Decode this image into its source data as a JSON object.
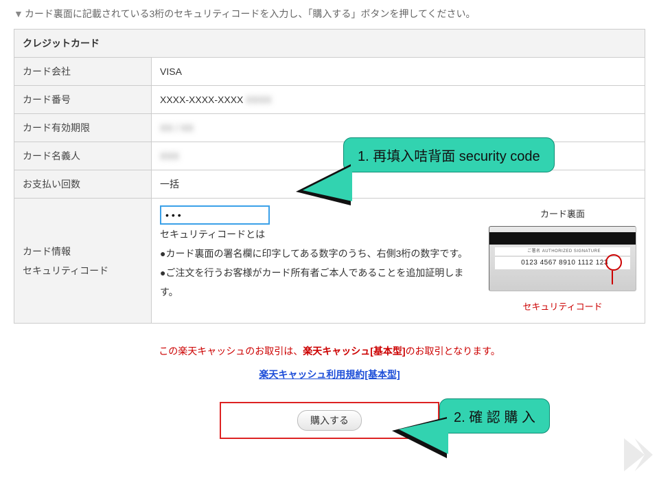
{
  "instruction": "カード裏面に記載されている3桁のセキュリティコードを入力し、「購入する」ボタンを押してください。",
  "table_header": "クレジットカード",
  "rows": {
    "card_company": {
      "label": "カード会社",
      "value": "VISA"
    },
    "card_number": {
      "label": "カード番号",
      "value": "XXXX-XXXX-XXXX",
      "masked_tail": "XXXX"
    },
    "expiry": {
      "label": "カード有効期限",
      "value_masked": "XX / XX"
    },
    "holder": {
      "label": "カード名義人",
      "value_masked": "XXX"
    },
    "installments": {
      "label": "お支払い回数",
      "value": "一括"
    }
  },
  "security": {
    "row_label_line1": "カード情報",
    "row_label_line2": "セキュリティコード",
    "input_value": "•••",
    "what_is": "セキュリティコードとは",
    "desc1": "●カード裏面の署名欄に印字してある数字のうち、右側3桁の数字です。",
    "desc2": "●ご注文を行うお客様がカード所有者ご本人であることを追加証明します。",
    "card_back_title": "カード裏面",
    "card_sig_text": "ご署名 AUTHORIZED SIGNATURE",
    "card_num_text": "0123 4567 8910 1112 123",
    "card_back_label": "セキュリティコード"
  },
  "notice": {
    "pre": "この楽天キャッシュのお取引は、",
    "bold": "楽天キャッシュ[基本型]",
    "post": "のお取引となります。"
  },
  "terms_link": "楽天キャッシュ利用規約[基本型]",
  "buy_button": "購入する",
  "callouts": {
    "c1": "1. 再填入咭背面 security code",
    "c2": "2. 確 認 購 入"
  }
}
